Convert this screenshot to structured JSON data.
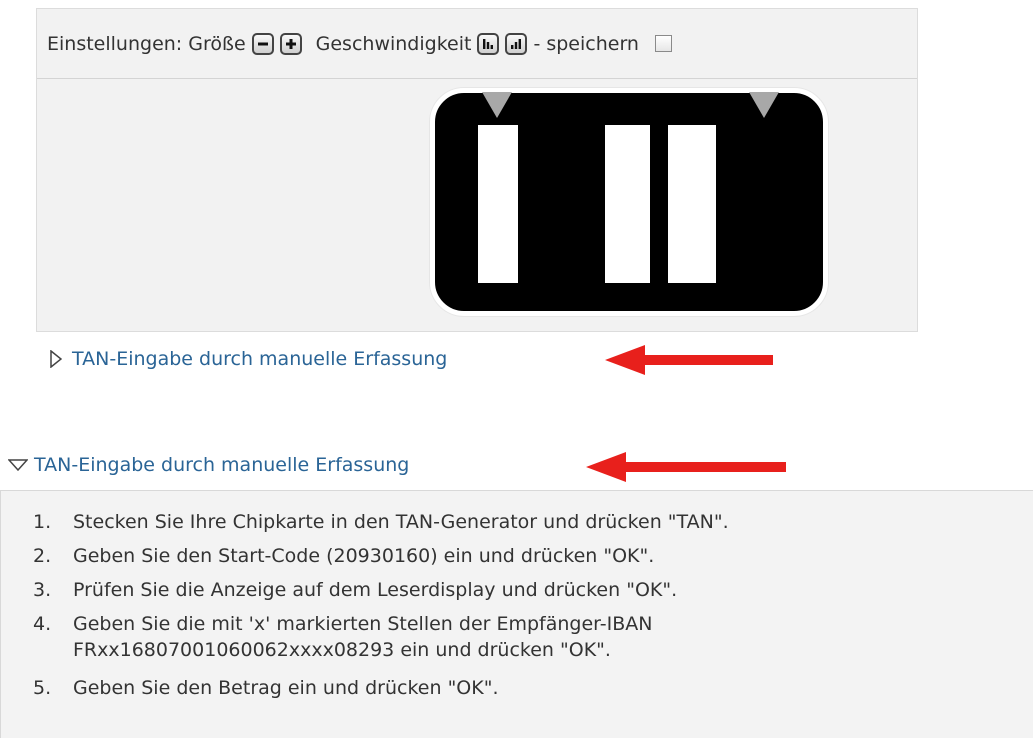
{
  "settings": {
    "label": "Einstellungen: Größe",
    "speed_label": "Geschwindigkeit",
    "save_label": "- speichern"
  },
  "colors": {
    "link": "#2a6496",
    "arrow": "#e8201c",
    "panel_bg": "#f2f2f2",
    "screen": "#000000"
  },
  "section_collapsed": {
    "label": "TAN-Eingabe durch manuelle Erfassung",
    "icon": "triangle-right-icon"
  },
  "section_expanded": {
    "label": "TAN-Eingabe durch manuelle Erfassung",
    "icon": "triangle-down-icon"
  },
  "steps": [
    {
      "num": "1.",
      "lines": [
        "Stecken Sie Ihre Chipkarte in den TAN-Generator und drücken \"TAN\"."
      ]
    },
    {
      "num": "2.",
      "lines": [
        "Geben Sie den Start-Code (20930160) ein und drücken \"OK\"."
      ]
    },
    {
      "num": "3.",
      "lines": [
        "Prüfen Sie die Anzeige auf dem Leserdisplay und drücken \"OK\"."
      ]
    },
    {
      "num": "4.",
      "lines": [
        "Geben Sie die mit 'x' markierten Stellen der Empfänger-IBAN",
        "FRxx16807001060062xxxx08293 ein und drücken \"OK\"."
      ]
    },
    {
      "num": "5.",
      "lines": [
        "Geben Sie den Betrag ein und drücken \"OK\"."
      ]
    }
  ]
}
